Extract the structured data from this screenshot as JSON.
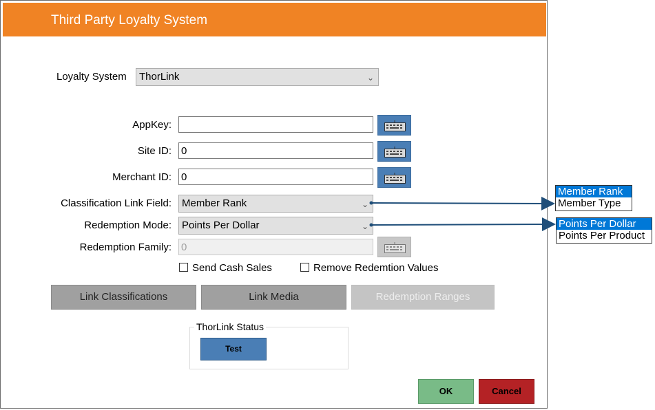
{
  "title": "Third Party Loyalty System",
  "loyalty_system": {
    "label": "Loyalty System",
    "value": "ThorLink"
  },
  "appkey": {
    "label": "AppKey:",
    "value": ""
  },
  "site_id": {
    "label": "Site ID:",
    "value": "0"
  },
  "merchant_id": {
    "label": "Merchant ID:",
    "value": "0"
  },
  "classification_link_field": {
    "label": "Classification Link Field:",
    "value": "Member Rank",
    "options": [
      "Member Rank",
      "Member Type"
    ]
  },
  "redemption_mode": {
    "label": "Redemption Mode:",
    "value": "Points Per Dollar",
    "options": [
      "Points Per Dollar",
      "Points Per Product"
    ]
  },
  "redemption_family": {
    "label": "Redemption Family:",
    "value": "0"
  },
  "send_cash_sales": {
    "label": "Send Cash Sales",
    "checked": false
  },
  "remove_redemption_values": {
    "label": "Remove Redemtion Values",
    "checked": false
  },
  "buttons": {
    "link_classifications": "Link Classifications",
    "link_media": "Link Media",
    "redemption_ranges": "Redemption Ranges",
    "test": "Test",
    "ok": "OK",
    "cancel": "Cancel"
  },
  "status_group": {
    "legend": "ThorLink Status"
  },
  "colors": {
    "titlebar": "#f08324",
    "keyboard_button": "#4a7eb5",
    "ok": "#79bb87",
    "cancel": "#b42225",
    "selected_option": "#0078d7",
    "connector": "#1f4e79"
  }
}
